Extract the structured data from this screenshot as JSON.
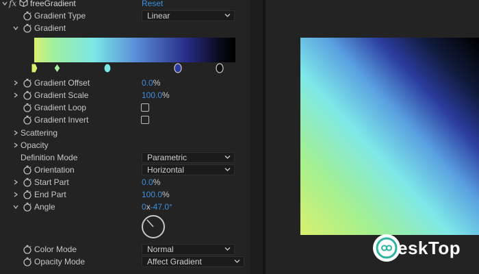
{
  "effect": {
    "fx_label": "fx",
    "name": "freeGradient",
    "reset_label": "Reset"
  },
  "rows": {
    "gradient_type": {
      "label": "Gradient Type",
      "value": "Linear"
    },
    "gradient": {
      "label": "Gradient"
    },
    "gradient_offset": {
      "label": "Gradient Offset",
      "value": "0.0",
      "unit": "%"
    },
    "gradient_scale": {
      "label": "Gradient Scale",
      "value": "100.0",
      "unit": "%"
    },
    "gradient_loop": {
      "label": "Gradient Loop",
      "checked": false
    },
    "gradient_invert": {
      "label": "Gradient Invert",
      "checked": false
    },
    "scattering": {
      "label": "Scattering"
    },
    "opacity": {
      "label": "Opacity"
    },
    "definition_mode": {
      "label": "Definition Mode",
      "value": "Parametric"
    },
    "orientation": {
      "label": "Orientation",
      "value": "Horizontal"
    },
    "start_part": {
      "label": "Start Part",
      "value": "0.0",
      "unit": "%"
    },
    "end_part": {
      "label": "End Part",
      "value": "100.0",
      "unit": "%"
    },
    "angle": {
      "label": "Angle",
      "turns": "0",
      "sep": "x",
      "degrees": "-47.0",
      "unit": "°"
    },
    "color_mode": {
      "label": "Color Mode",
      "value": "Normal"
    },
    "opacity_mode": {
      "label": "Opacity Mode",
      "value": "Affect Gradient"
    }
  },
  "gradient_stops": [
    {
      "color": "#d6f06a",
      "shape": "flag"
    },
    {
      "color": "#a8f0a0",
      "shape": "diamond"
    },
    {
      "color": "#7ae6e6",
      "shape": "circle"
    },
    {
      "color": "#2a3a9e",
      "shape": "circle"
    },
    {
      "color": "#111111",
      "shape": "circle"
    }
  ],
  "icons": {
    "stopwatch": "stopwatch-icon",
    "twirl_open": "chevron-down-icon",
    "twirl_closed": "chevron-right-icon"
  },
  "colors": {
    "accent_blue": "#3d8fe0",
    "panel_bg": "#232323"
  },
  "watermark": {
    "text": "eskTop"
  }
}
